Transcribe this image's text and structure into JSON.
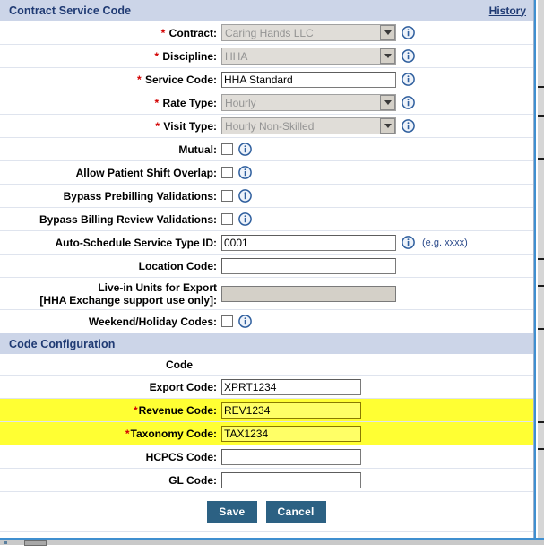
{
  "header": {
    "title": "Contract Service Code",
    "history_link": "History"
  },
  "fields": [
    {
      "label": "Contract:",
      "required": true,
      "type": "select",
      "value": "Caring Hands LLC",
      "disabled": true,
      "info": true,
      "name": "contract"
    },
    {
      "label": "Discipline:",
      "required": true,
      "type": "select",
      "value": "HHA",
      "disabled": true,
      "info": true,
      "name": "discipline"
    },
    {
      "label": "Service Code:",
      "required": true,
      "type": "text",
      "value": "HHA Standard",
      "disabled": false,
      "info": true,
      "name": "service-code"
    },
    {
      "label": "Rate Type:",
      "required": true,
      "type": "select",
      "value": "Hourly",
      "disabled": true,
      "info": true,
      "name": "rate-type"
    },
    {
      "label": "Visit Type:",
      "required": true,
      "type": "select",
      "value": "Hourly Non-Skilled",
      "disabled": true,
      "info": true,
      "name": "visit-type"
    },
    {
      "label": "Mutual:",
      "required": false,
      "type": "checkbox",
      "checked": false,
      "info": true,
      "name": "mutual"
    },
    {
      "label": "Allow Patient Shift Overlap:",
      "required": false,
      "type": "checkbox",
      "checked": false,
      "info": true,
      "name": "allow-patient-shift-overlap"
    },
    {
      "label": "Bypass Prebilling Validations:",
      "required": false,
      "type": "checkbox",
      "checked": false,
      "info": true,
      "name": "bypass-prebilling-validations"
    },
    {
      "label": "Bypass Billing Review Validations:",
      "required": false,
      "type": "checkbox",
      "checked": false,
      "info": true,
      "name": "bypass-billing-review-validations"
    },
    {
      "label": "Auto-Schedule Service Type ID:",
      "required": false,
      "type": "text",
      "value": "0001",
      "disabled": false,
      "info": true,
      "hint": "(e.g. xxxx)",
      "name": "auto-schedule-service-type-id"
    },
    {
      "label": "Location Code:",
      "required": false,
      "type": "text",
      "value": "",
      "disabled": false,
      "info": false,
      "name": "location-code"
    },
    {
      "label": "Live-in Units for Export [HHA Exchange support use only]:",
      "label_line1": "Live-in Units for Export",
      "label_line2": "[HHA Exchange support use only]:",
      "required": false,
      "type": "text",
      "value": "",
      "disabled": true,
      "info": false,
      "name": "live-in-units-for-export"
    },
    {
      "label": "Weekend/Holiday Codes:",
      "required": false,
      "type": "checkbox",
      "checked": false,
      "info": true,
      "name": "weekend-holiday-codes"
    }
  ],
  "code_config": {
    "section_title": "Code Configuration",
    "column_header": "Code",
    "rows": [
      {
        "label": "Export Code:",
        "required": false,
        "value": "XPRT1234",
        "highlight": false,
        "name": "export-code"
      },
      {
        "label": "Revenue Code:",
        "required": true,
        "value": "REV1234",
        "highlight": true,
        "name": "revenue-code"
      },
      {
        "label": "Taxonomy Code:",
        "required": true,
        "value": "TAX1234",
        "highlight": true,
        "name": "taxonomy-code"
      },
      {
        "label": "HCPCS Code:",
        "required": false,
        "value": "",
        "highlight": false,
        "name": "hcpcs-code"
      },
      {
        "label": "GL Code:",
        "required": false,
        "value": "",
        "highlight": false,
        "name": "gl-code"
      }
    ]
  },
  "buttons": {
    "save": "Save",
    "cancel": "Cancel"
  },
  "colors": {
    "section_bar": "#ccd5e8",
    "section_text": "#1f3a73",
    "required_star": "#d20000",
    "highlight": "#ffff33",
    "button": "#2c6183",
    "info_icon": "#2f5f9e"
  },
  "icons": {
    "info": "info-icon",
    "dropdown": "chevron-down-icon"
  }
}
